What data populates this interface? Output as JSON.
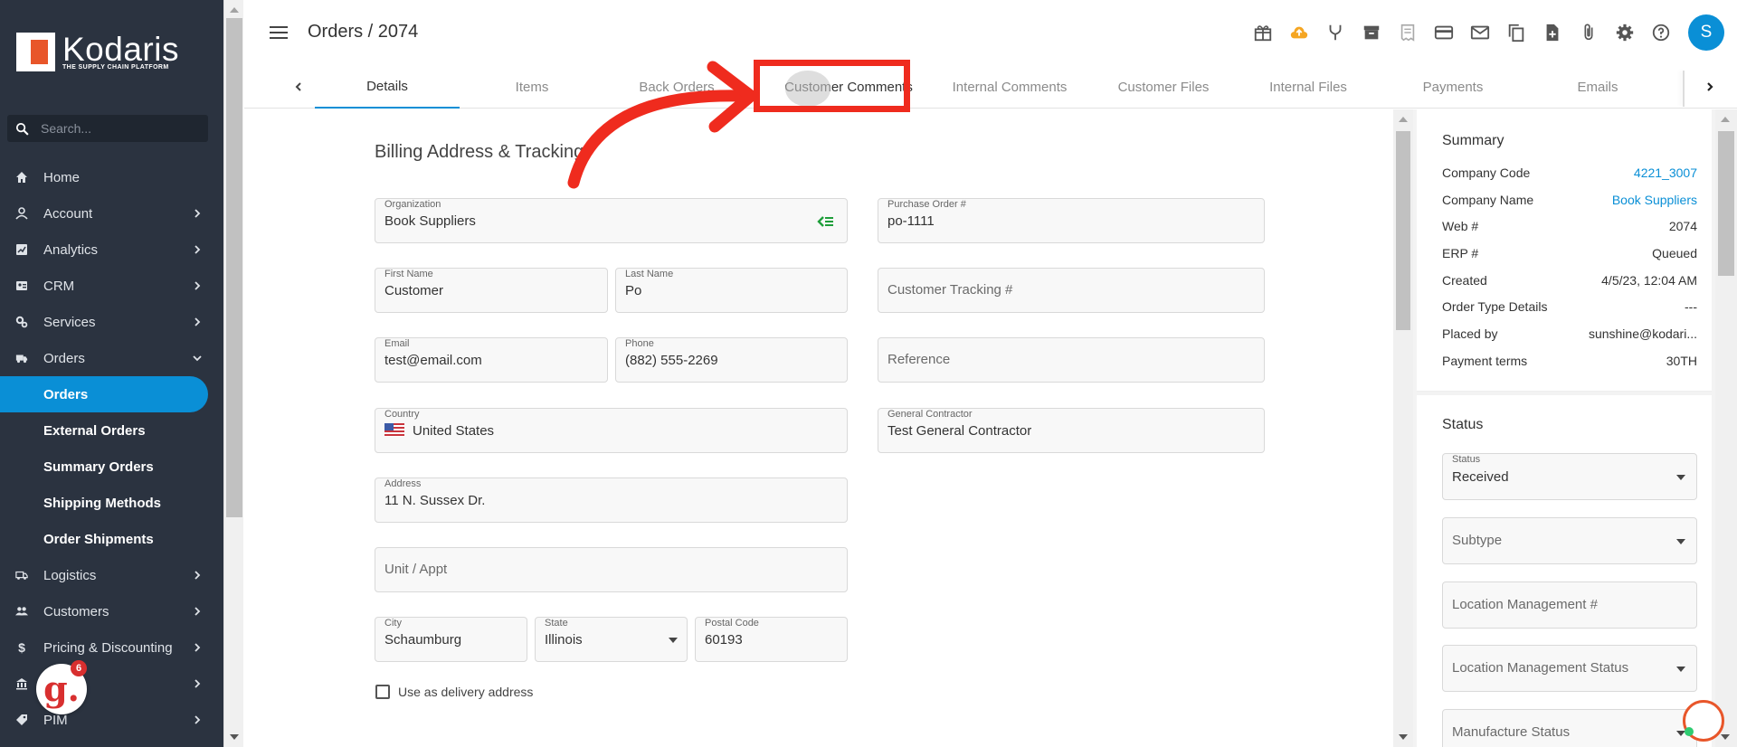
{
  "brand": {
    "name": "Kodaris",
    "tagline": "THE SUPPLY CHAIN PLATFORM",
    "accent": "#0a8fd6",
    "sidebar_bg": "#2b3340"
  },
  "sidebar": {
    "search_placeholder": "Search...",
    "items": [
      {
        "label": "Home",
        "icon": "home-icon",
        "expandable": false
      },
      {
        "label": "Account",
        "icon": "person-icon",
        "expandable": true
      },
      {
        "label": "Analytics",
        "icon": "chart-icon",
        "expandable": true
      },
      {
        "label": "CRM",
        "icon": "id-card-icon",
        "expandable": true
      },
      {
        "label": "Services",
        "icon": "gears-icon",
        "expandable": true
      },
      {
        "label": "Orders",
        "icon": "truck-icon",
        "expandable": true,
        "expanded": true
      }
    ],
    "sub_items": [
      {
        "label": "Orders",
        "active": true
      },
      {
        "label": "External Orders"
      },
      {
        "label": "Summary Orders"
      },
      {
        "label": "Shipping Methods"
      },
      {
        "label": "Order Shipments"
      }
    ],
    "items_after": [
      {
        "label": "Logistics",
        "icon": "truck-icon"
      },
      {
        "label": "Customers",
        "icon": "people-icon"
      },
      {
        "label": "Pricing & Discounting",
        "icon": "dollar-icon"
      },
      {
        "label": "",
        "icon": "bank-icon"
      },
      {
        "label": "PIM",
        "icon": "tag-icon"
      }
    ],
    "notification_badge": {
      "letter": "g.",
      "count": "6"
    }
  },
  "header": {
    "title": "Orders / 2074",
    "toolbar_icons": [
      "gift-icon",
      "cloud-upload-icon",
      "merge-icon",
      "archive-icon",
      "receipt-icon",
      "credit-card-icon",
      "mail-icon",
      "copy-icon",
      "add-file-icon",
      "attachment-icon",
      "settings-icon",
      "help-icon"
    ],
    "avatar_initial": "S"
  },
  "tabs": [
    {
      "label": "Details",
      "active": true
    },
    {
      "label": "Items"
    },
    {
      "label": "Back Orders"
    },
    {
      "label": "Customer Comments",
      "highlighted": true
    },
    {
      "label": "Internal Comments"
    },
    {
      "label": "Customer Files"
    },
    {
      "label": "Internal Files"
    },
    {
      "label": "Payments"
    },
    {
      "label": "Emails"
    }
  ],
  "form": {
    "section_title": "Billing Address & Tracking",
    "organization": {
      "label": "Organization",
      "value": "Book Suppliers"
    },
    "purchase_order": {
      "label": "Purchase Order #",
      "value": "po-1111"
    },
    "first_name": {
      "label": "First Name",
      "value": "Customer"
    },
    "last_name": {
      "label": "Last Name",
      "value": "Po"
    },
    "customer_tracking": {
      "placeholder": "Customer Tracking #"
    },
    "email": {
      "label": "Email",
      "value": "test@email.com"
    },
    "phone": {
      "label": "Phone",
      "value": "(882) 555-2269"
    },
    "reference": {
      "placeholder": "Reference"
    },
    "country": {
      "label": "Country",
      "value": "United States"
    },
    "general_contractor": {
      "label": "General Contractor",
      "value": "Test General Contractor"
    },
    "address": {
      "label": "Address",
      "value": "11 N. Sussex Dr."
    },
    "unit": {
      "placeholder": "Unit / Appt"
    },
    "city": {
      "label": "City",
      "value": "Schaumburg"
    },
    "state": {
      "label": "State",
      "value": "Illinois"
    },
    "postal_code": {
      "label": "Postal Code",
      "value": "60193"
    },
    "use_as_delivery": {
      "label": "Use as delivery address",
      "checked": false
    }
  },
  "summary": {
    "title": "Summary",
    "rows": [
      {
        "key": "Company Code",
        "value": "4221_3007",
        "link": true
      },
      {
        "key": "Company Name",
        "value": "Book Suppliers",
        "link": true
      },
      {
        "key": "Web #",
        "value": "2074"
      },
      {
        "key": "ERP #",
        "value": "Queued"
      },
      {
        "key": "Created",
        "value": "4/5/23, 12:04 AM"
      },
      {
        "key": "Order Type Details",
        "value": "---"
      },
      {
        "key": "Placed by",
        "value": "sunshine@kodari..."
      },
      {
        "key": "Payment terms",
        "value": "30TH"
      }
    ]
  },
  "status": {
    "title": "Status",
    "status_field": {
      "label": "Status",
      "value": "Received"
    },
    "subtype": {
      "placeholder": "Subtype"
    },
    "location_management": {
      "placeholder": "Location Management #"
    },
    "location_management_status": {
      "placeholder": "Location Management Status"
    },
    "manufacture_status": {
      "placeholder": "Manufacture Status"
    }
  },
  "annotation": {
    "color": "#ef2b1e"
  }
}
